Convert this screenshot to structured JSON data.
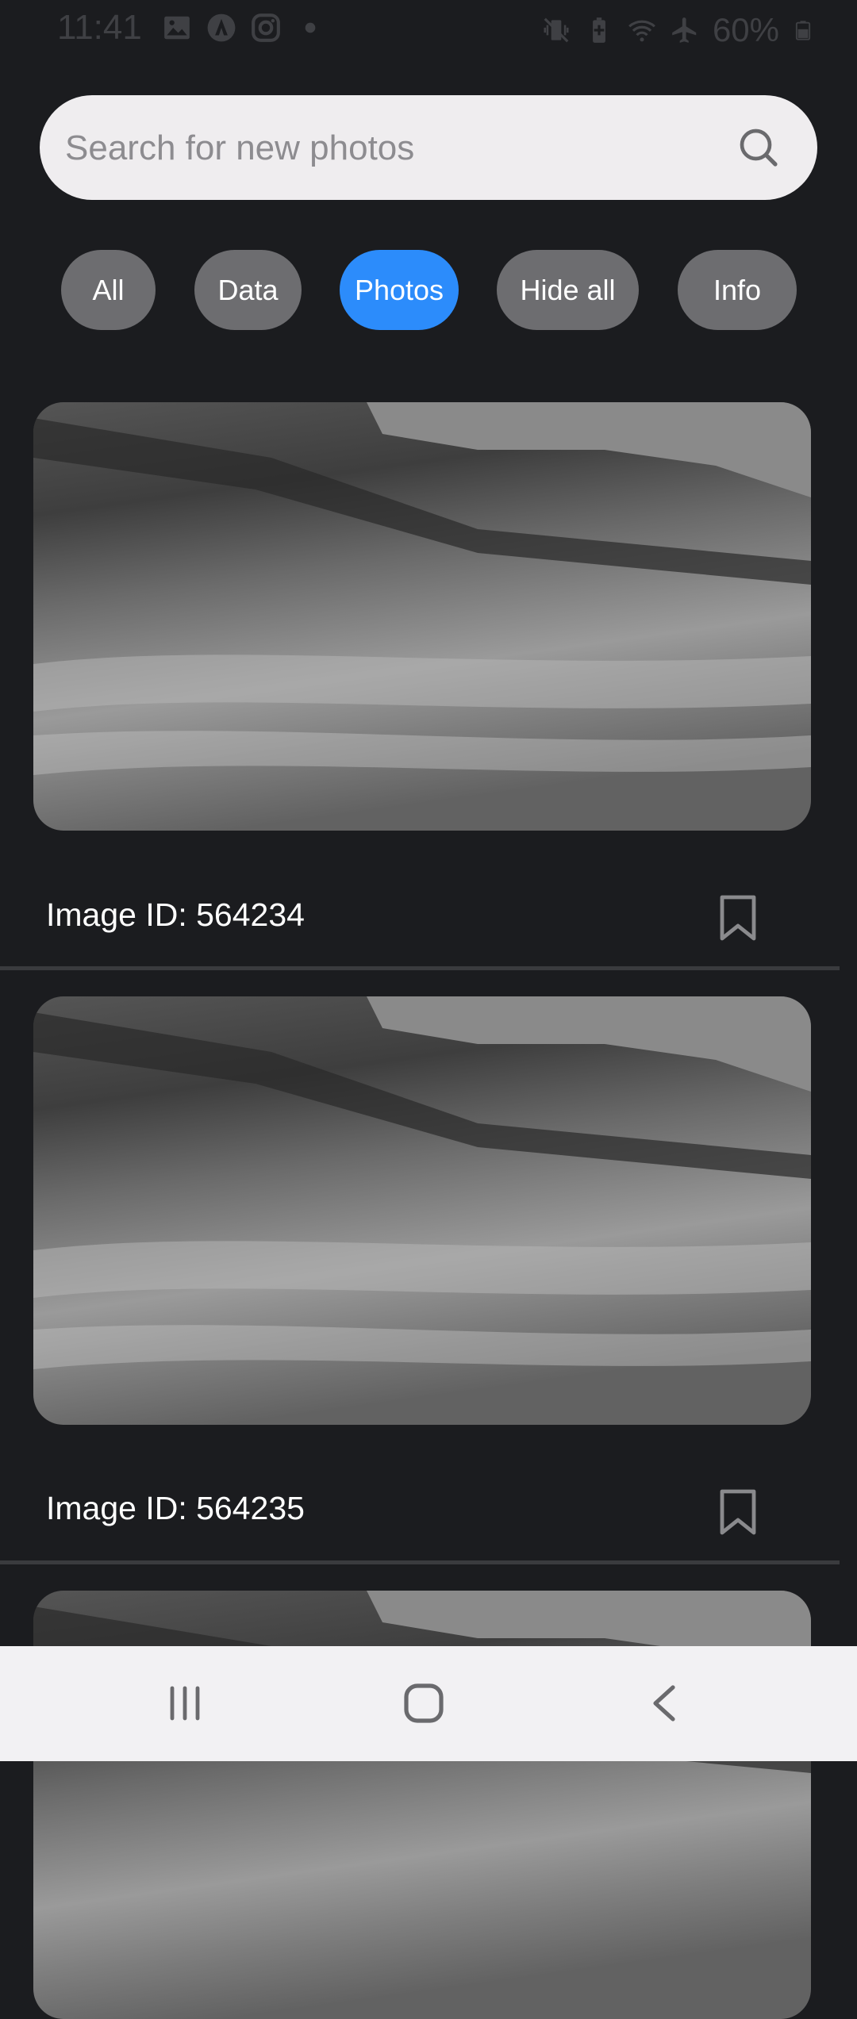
{
  "status_bar": {
    "time": "11:41",
    "battery": "60%",
    "left_icons": [
      "gallery-icon",
      "app-a-icon",
      "instagram-icon",
      "dot-icon"
    ],
    "right_icons": [
      "vibrate-icon",
      "battery-saver-icon",
      "wifi-icon",
      "airplane-icon",
      "battery-icon"
    ]
  },
  "search": {
    "placeholder": "Search for new photos",
    "value": ""
  },
  "filters": [
    {
      "label": "All",
      "active": false
    },
    {
      "label": "Data",
      "active": false
    },
    {
      "label": "Photos",
      "active": true
    },
    {
      "label": "Hide all",
      "active": false
    },
    {
      "label": "Info",
      "active": false
    }
  ],
  "colors": {
    "background": "#1b1c1f",
    "chip": "#6d6d70",
    "chip_active": "#2c8cfb",
    "search_bg": "#efedef"
  },
  "cards": [
    {
      "caption": "Image ID: 564234",
      "icon": "bookmark-icon"
    },
    {
      "caption": "Image ID: 564235",
      "icon": "bookmark-icon"
    },
    {
      "caption": "",
      "icon": ""
    }
  ],
  "navigation": {
    "recent": "recent-apps-icon",
    "home": "home-icon",
    "back": "back-icon"
  }
}
